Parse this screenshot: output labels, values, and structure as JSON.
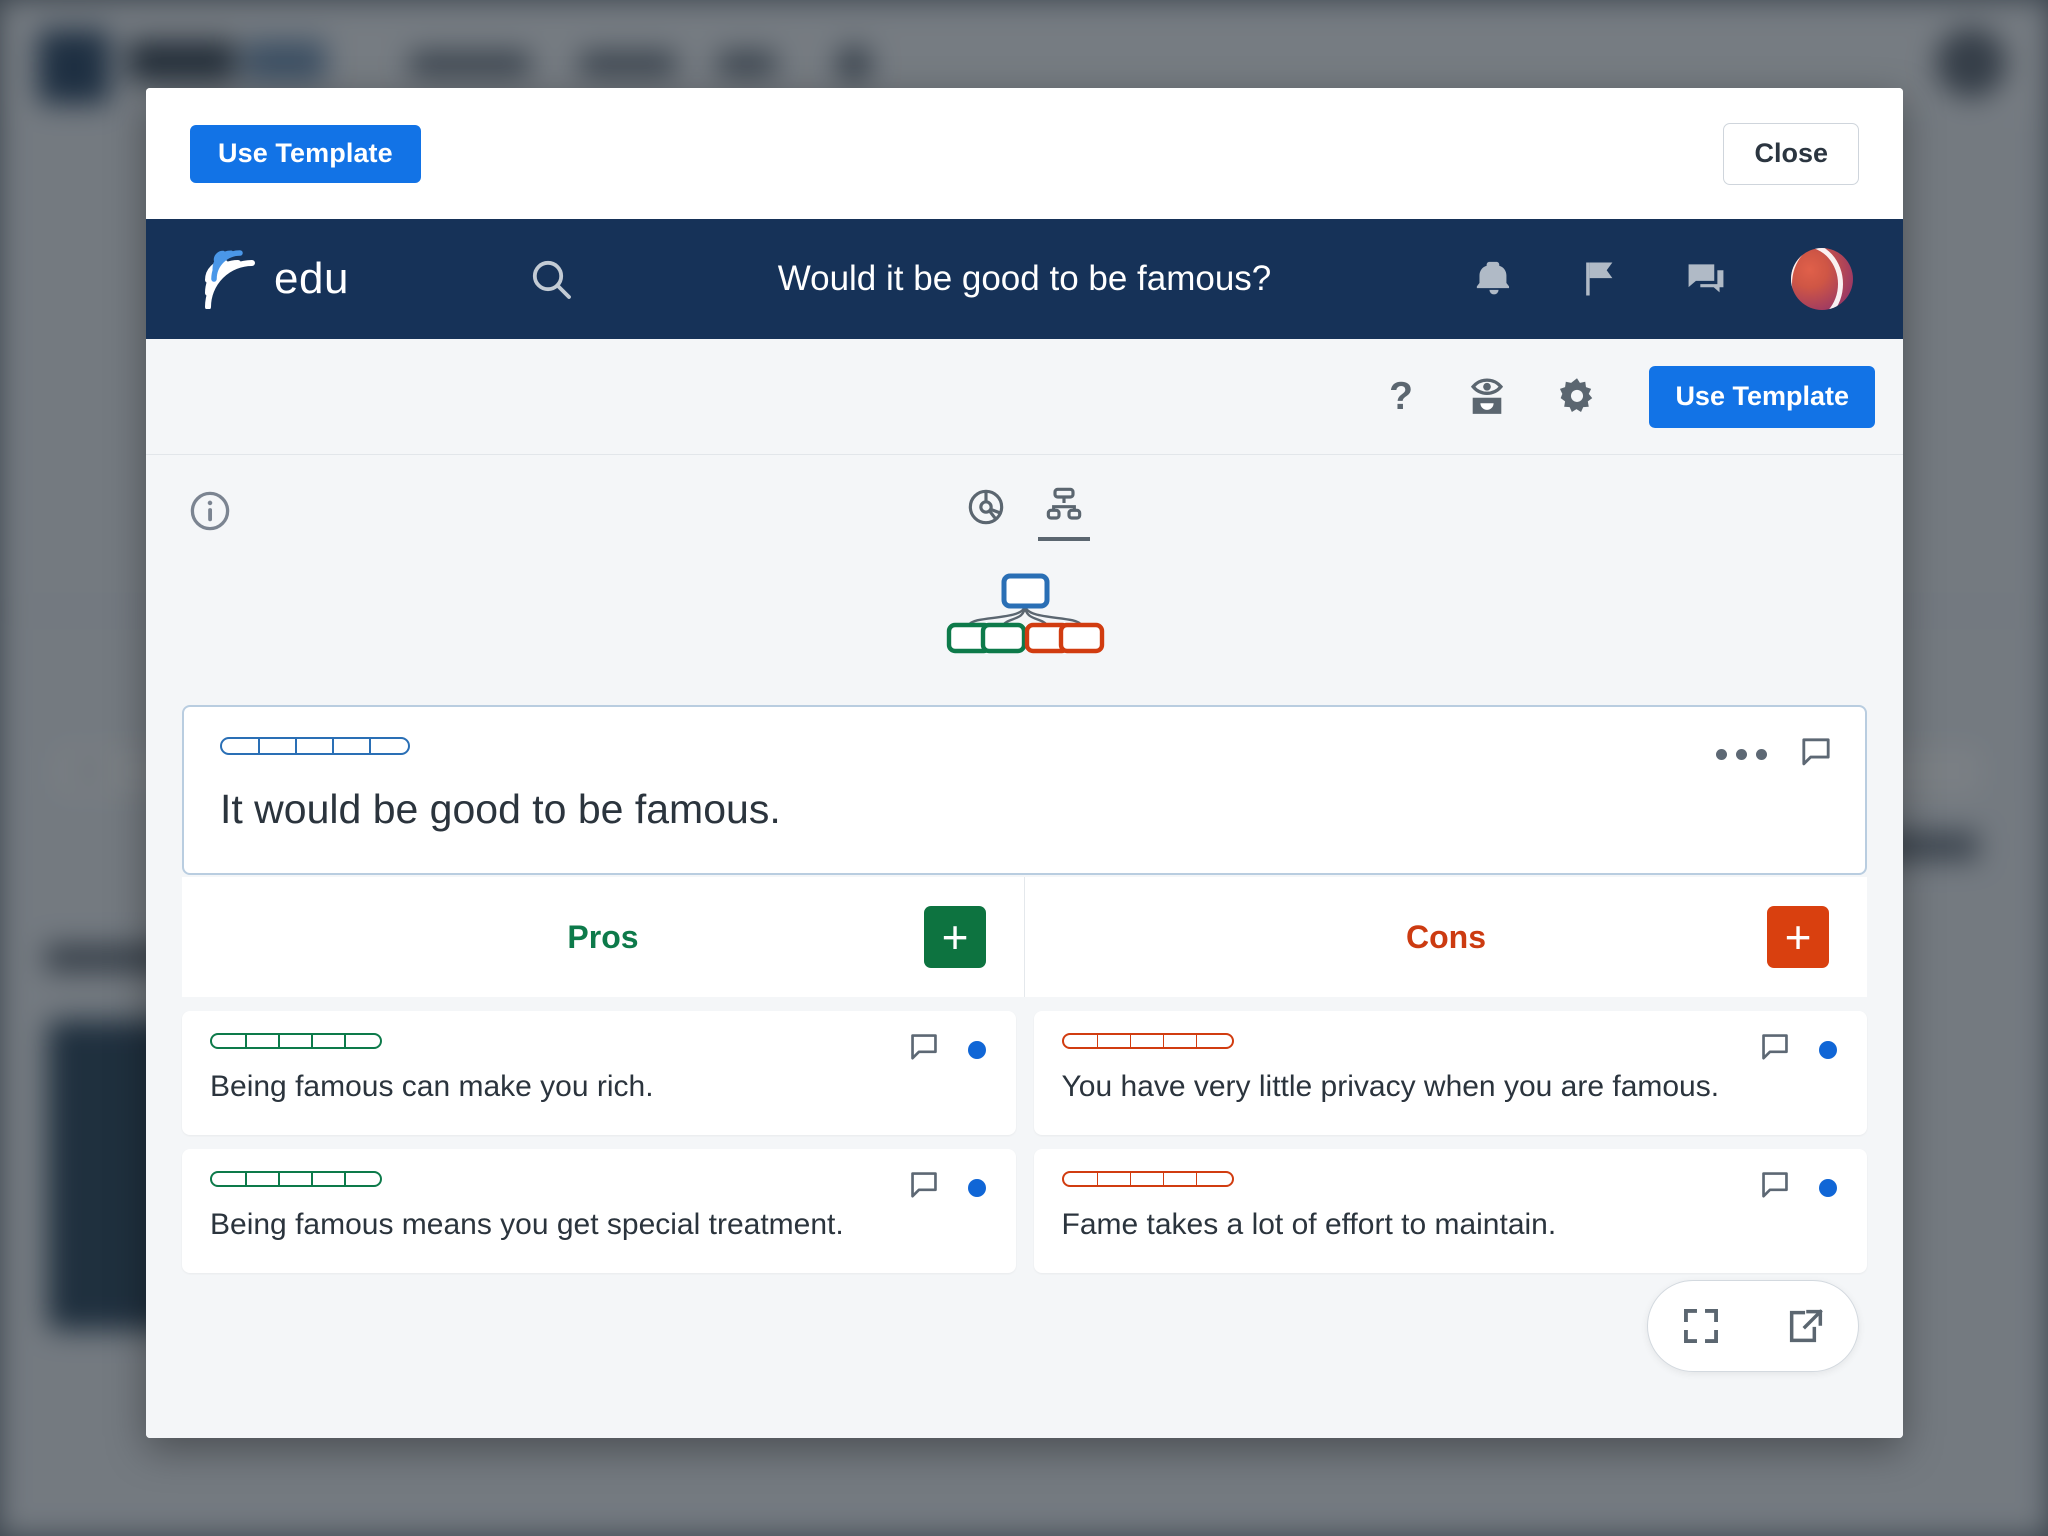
{
  "modal": {
    "use_template_top_label": "Use Template",
    "close_label": "Close"
  },
  "app_header": {
    "brand_text": "edu",
    "logo_icon": "kialo-waves-logo-icon",
    "menu_icon": "hamburger-menu-icon",
    "search_icon": "search-icon",
    "title": "Would it be good to be famous?",
    "notifications_icon": "bell-icon",
    "flag_icon": "flag-icon",
    "messages_icon": "chat-bubbles-icon",
    "avatar_icon": "user-avatar"
  },
  "toolbar": {
    "help_icon": "question-mark-icon",
    "watch_icon": "eye-over-tray-icon",
    "settings_icon": "gear-icon",
    "use_template_label": "Use Template"
  },
  "viz": {
    "info_icon": "info-circle-icon",
    "tabs": [
      {
        "icon": "pie-chart-icon",
        "name": "perspectives-view",
        "active": false
      },
      {
        "icon": "tree-hierarchy-icon",
        "name": "tree-view",
        "active": true
      }
    ],
    "tree_preview": {
      "root_color": "#2a6fb5",
      "children": [
        "#0d7a4a",
        "#0d7a4a",
        "#d13c10",
        "#d13c10"
      ]
    }
  },
  "claim": {
    "badge_icon": "impact-bar-blue",
    "text": "It would be good to be famous.",
    "more_icon": "more-options-icon",
    "comment_icon": "comment-icon"
  },
  "columns": {
    "pros": {
      "title": "Pros",
      "color": "#0d7a4a",
      "add_label": "+",
      "items": [
        {
          "text": "Being famous can make you rich.",
          "badge": "impact-bar-green",
          "comment_icon": "comment-icon",
          "dot": "unread-dot"
        },
        {
          "text": "Being famous means you get special treatment.",
          "badge": "impact-bar-green",
          "comment_icon": "comment-icon",
          "dot": "unread-dot"
        }
      ]
    },
    "cons": {
      "title": "Cons",
      "color": "#cc3b11",
      "add_label": "+",
      "items": [
        {
          "text": "You have very little privacy when you are famous.",
          "badge": "impact-bar-red",
          "comment_icon": "comment-icon",
          "dot": "unread-dot"
        },
        {
          "text": "Fame takes a lot of effort to maintain.",
          "badge": "impact-bar-red",
          "comment_icon": "comment-icon",
          "dot": "unread-dot"
        }
      ]
    }
  },
  "float_pill": {
    "fullscreen_icon": "fullscreen-icon",
    "open_external_icon": "open-external-icon"
  },
  "colors": {
    "accent_blue": "#1273e6",
    "header_navy": "#163258",
    "pro_green": "#0d7a4a",
    "con_red": "#cc3b11"
  }
}
